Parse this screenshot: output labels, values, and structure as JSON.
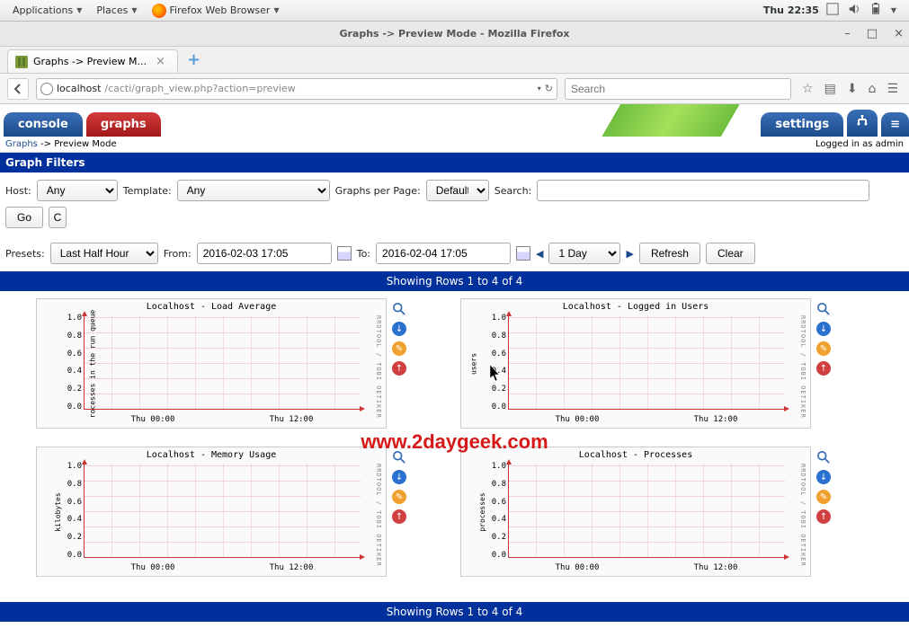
{
  "gnome": {
    "applications": "Applications",
    "places": "Places",
    "app_name": "Firefox Web Browser",
    "clock": "Thu 22:35"
  },
  "window": {
    "title": "Graphs -> Preview Mode - Mozilla Firefox"
  },
  "tab": {
    "label": "Graphs -> Preview M..."
  },
  "url": {
    "host": "localhost",
    "path": "/cacti/graph_view.php?action=preview",
    "search_placeholder": "Search"
  },
  "cacti_tabs": {
    "console": "console",
    "graphs": "graphs",
    "settings": "settings"
  },
  "breadcrumb": {
    "root": "Graphs",
    "sep": " -> ",
    "leaf": "Preview Mode",
    "login": "Logged in as admin"
  },
  "panel": {
    "title": "Graph Filters"
  },
  "filters": {
    "host_label": "Host:",
    "host_value": "Any",
    "template_label": "Template:",
    "template_value": "Any",
    "gpp_label": "Graphs per Page:",
    "gpp_value": "Default",
    "search_label": "Search:",
    "go": "Go",
    "presets_label": "Presets:",
    "presets_value": "Last Half Hour",
    "from_label": "From:",
    "from_value": "2016-02-03 17:05",
    "to_label": "To:",
    "to_value": "2016-02-04 17:05",
    "span_value": "1 Day",
    "refresh": "Refresh",
    "clear": "Clear"
  },
  "rows_banner": "Showing Rows 1 to 4 of 4",
  "watermark": "www.2daygeek.com",
  "rrd_credit": "RRDTOOL / TOBI OETIKER",
  "charts": [
    {
      "title": "Localhost - Load Average",
      "ylabel": "rocesses in the run queue"
    },
    {
      "title": "Localhost - Logged in Users",
      "ylabel": "users"
    },
    {
      "title": "Localhost - Memory Usage",
      "ylabel": "kilobytes"
    },
    {
      "title": "Localhost - Processes",
      "ylabel": "processes"
    }
  ],
  "chart_data": [
    {
      "type": "line",
      "title": "Localhost - Load Average",
      "ylabel": "processes in the run queue",
      "ylim": [
        0.0,
        1.0
      ],
      "yticks": [
        1.0,
        0.8,
        0.6,
        0.4,
        0.2,
        0.0
      ],
      "xticks": [
        "Thu 00:00",
        "Thu 12:00"
      ],
      "series": []
    },
    {
      "type": "line",
      "title": "Localhost - Logged in Users",
      "ylabel": "users",
      "ylim": [
        0.0,
        1.0
      ],
      "yticks": [
        1.0,
        0.8,
        0.6,
        0.4,
        0.2,
        0.0
      ],
      "xticks": [
        "Thu 00:00",
        "Thu 12:00"
      ],
      "series": []
    },
    {
      "type": "line",
      "title": "Localhost - Memory Usage",
      "ylabel": "kilobytes",
      "ylim": [
        0.0,
        1.0
      ],
      "yticks": [
        1.0,
        0.8,
        0.6,
        0.4,
        0.2,
        0.0
      ],
      "xticks": [
        "Thu 00:00",
        "Thu 12:00"
      ],
      "series": []
    },
    {
      "type": "line",
      "title": "Localhost - Processes",
      "ylabel": "processes",
      "ylim": [
        0.0,
        1.0
      ],
      "yticks": [
        1.0,
        0.8,
        0.6,
        0.4,
        0.2,
        0.0
      ],
      "xticks": [
        "Thu 00:00",
        "Thu 12:00"
      ],
      "series": []
    }
  ]
}
